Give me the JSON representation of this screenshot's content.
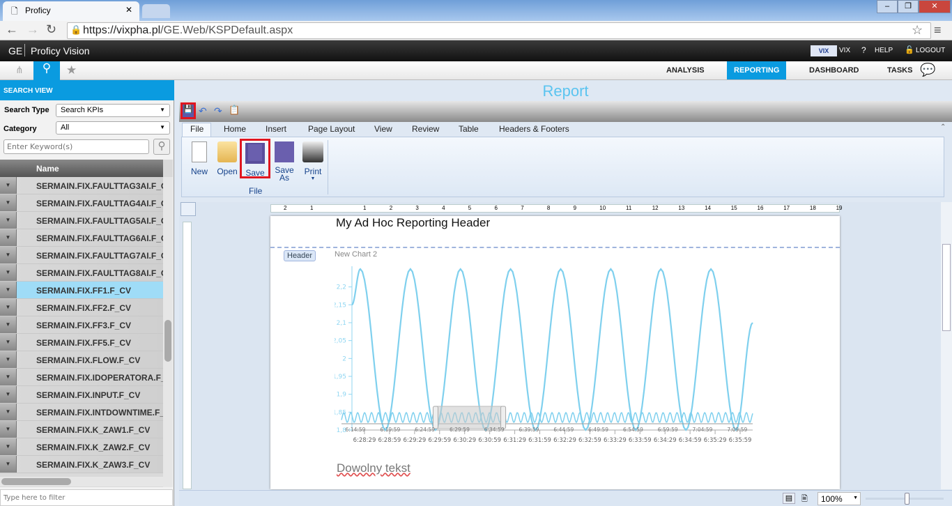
{
  "browser": {
    "tab_title": "Proficy",
    "url_host": "https://vixpha.pl",
    "url_path": "/GE.Web/KSPDefault.aspx"
  },
  "app": {
    "brand": "GE",
    "title": "Proficy Vision",
    "user": "VIX",
    "help": "HELP",
    "logout": "LOGOUT",
    "nav_tabs": [
      "ANALYSIS",
      "REPORTING",
      "DASHBOARD",
      "TASKS"
    ],
    "active_tab": "REPORTING",
    "accent": "#0a9be0"
  },
  "sidebar": {
    "header": "SEARCH VIEW",
    "search_type_label": "Search Type",
    "search_type_value": "Search KPIs",
    "category_label": "Category",
    "category_value": "All",
    "keyword_placeholder": "Enter Keyword(s)",
    "column_name": "Name",
    "filter_placeholder": "Type here to filter",
    "items": [
      "SERMAIN.FIX.FAULTTAG3AI.F_C",
      "SERMAIN.FIX.FAULTTAG4AI.F_C",
      "SERMAIN.FIX.FAULTTAG5AI.F_C",
      "SERMAIN.FIX.FAULTTAG6AI.F_C",
      "SERMAIN.FIX.FAULTTAG7AI.F_C",
      "SERMAIN.FIX.FAULTTAG8AI.F_C",
      "SERMAIN.FIX.FF1.F_CV",
      "SERMAIN.FIX.FF2.F_CV",
      "SERMAIN.FIX.FF3.F_CV",
      "SERMAIN.FIX.FF5.F_CV",
      "SERMAIN.FIX.FLOW.F_CV",
      "SERMAIN.FIX.IDOPERATORA.F_",
      "SERMAIN.FIX.INPUT.F_CV",
      "SERMAIN.FIX.INTDOWNTIME.F_",
      "SERMAIN.FIX.K_ZAW1.F_CV",
      "SERMAIN.FIX.K_ZAW2.F_CV",
      "SERMAIN.FIX.K_ZAW3.F_CV"
    ],
    "selected": "SERMAIN.FIX.FF1.F_CV"
  },
  "report": {
    "title": "Report",
    "ribbon_tabs": [
      "File",
      "Home",
      "Insert",
      "Page Layout",
      "View",
      "Review",
      "Table",
      "Headers & Footers"
    ],
    "buttons": {
      "new": "New",
      "open": "Open",
      "save": "Save",
      "save_as": "Save As",
      "print": "Print"
    },
    "group": "File",
    "header_text": "My Ad Hoc Reporting Header",
    "header_tag": "Header",
    "body_text": "Dowolny tekst",
    "ruler": [
      "2",
      "1",
      "1",
      "2",
      "3",
      "4",
      "5",
      "6",
      "7",
      "8",
      "9",
      "10",
      "11",
      "12",
      "13",
      "14",
      "15",
      "16",
      "17",
      "18",
      "19"
    ],
    "zoom": "100%"
  },
  "chart_data": {
    "type": "line",
    "title": "New Chart 2",
    "color": "#7fd0ee",
    "ylim": [
      1.8,
      2.25
    ],
    "yticks": [
      "1,8",
      "1,85",
      "1,9",
      "1,95",
      "2",
      "2,05",
      "2,1",
      "2,15",
      "2,2"
    ],
    "xticks": [
      "6:28:29",
      "6:28:59",
      "6:29:29",
      "6:29:59",
      "6:30:29",
      "6:30:59",
      "6:31:29",
      "6:31:59",
      "6:32:29",
      "6:32:59",
      "6:33:29",
      "6:33:59",
      "6:34:29",
      "6:34:59",
      "6:35:29",
      "6:35:59"
    ],
    "points": [
      [
        "6:28:14",
        2.15
      ],
      [
        "6:28:24",
        2.25
      ],
      [
        "6:28:54",
        1.8
      ],
      [
        "6:29:24",
        2.25
      ],
      [
        "6:29:54",
        1.8
      ],
      [
        "6:30:24",
        2.25
      ],
      [
        "6:30:54",
        1.8
      ],
      [
        "6:31:24",
        2.25
      ],
      [
        "6:31:54",
        1.8
      ],
      [
        "6:32:24",
        2.25
      ],
      [
        "6:32:54",
        1.8
      ],
      [
        "6:33:24",
        2.25
      ],
      [
        "6:33:54",
        1.8
      ],
      [
        "6:34:24",
        2.25
      ],
      [
        "6:34:54",
        1.8
      ],
      [
        "6:35:24",
        2.25
      ],
      [
        "6:35:54",
        1.8
      ],
      [
        "6:36:14",
        2.1
      ]
    ],
    "navigator_ticks": [
      "6:14:59",
      "6:19:59",
      "6:24:59",
      "6:29:59",
      "6:34:59",
      "6:39:59",
      "6:44:59",
      "6:49:59",
      "6:54:59",
      "6:59:59",
      "7:04:59",
      "7:09:59"
    ]
  }
}
